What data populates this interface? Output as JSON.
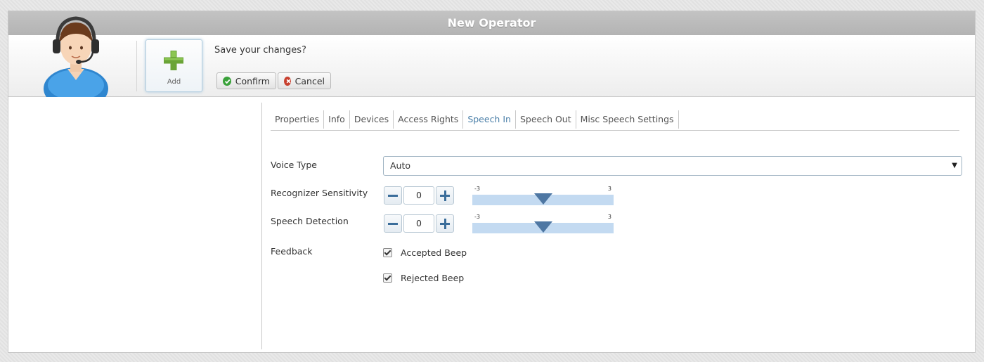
{
  "window": {
    "title": "New Operator"
  },
  "toolbar": {
    "add_label": "Add",
    "prompt": "Save your changes?",
    "confirm_label": "Confirm",
    "cancel_label": "Cancel"
  },
  "tabs": [
    {
      "label": "Properties",
      "active": false
    },
    {
      "label": "Info",
      "active": false
    },
    {
      "label": "Devices",
      "active": false
    },
    {
      "label": "Access Rights",
      "active": false
    },
    {
      "label": "Speech In",
      "active": true
    },
    {
      "label": "Speech Out",
      "active": false
    },
    {
      "label": "Misc Speech Settings",
      "active": false
    }
  ],
  "form": {
    "voice_type": {
      "label": "Voice Type",
      "value": "Auto"
    },
    "recognizer_sensitivity": {
      "label": "Recognizer Sensitivity",
      "value": "0",
      "min_label": "-3",
      "max_label": "3",
      "slider_value": 0
    },
    "speech_detection": {
      "label": "Speech Detection",
      "value": "0",
      "min_label": "-3",
      "max_label": "3",
      "slider_value": 0
    },
    "feedback": {
      "label": "Feedback",
      "accepted_beep": {
        "label": "Accepted Beep",
        "checked": true
      },
      "rejected_beep": {
        "label": "Rejected Beep",
        "checked": true
      }
    }
  },
  "colors": {
    "accent": "#4a7fa8",
    "slider_track": "#c3daf1",
    "slider_thumb": "#4e77a3"
  }
}
